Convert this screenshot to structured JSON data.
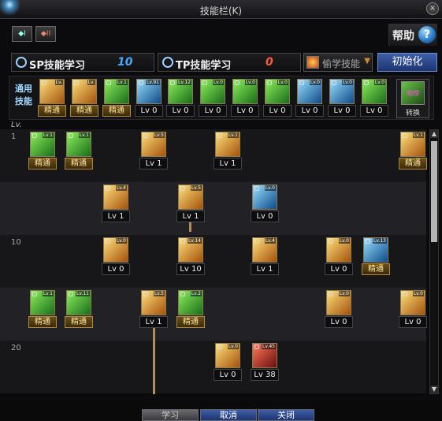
{
  "window": {
    "title": "技能栏(K)",
    "close_glyph": "×"
  },
  "tabs": [
    {
      "label": "◆I"
    },
    {
      "label": "◆II"
    }
  ],
  "help": {
    "label": "帮助",
    "icon": "?"
  },
  "points": {
    "sp": {
      "label": "SP技能学习",
      "value": "10",
      "color": "#4aa8ff"
    },
    "tp": {
      "label": "TP技能学习",
      "value": "0",
      "color": "#ff5a3a"
    }
  },
  "steal_dropdown": {
    "label": "偷学技能",
    "arrow": "▼"
  },
  "reset_button": {
    "label": "初始化"
  },
  "common": {
    "tag_line1": "通用",
    "tag_line2": "技能",
    "skills": [
      {
        "tag": "Lv.",
        "cap": "精通",
        "style": "mastered",
        "tone": "gold"
      },
      {
        "tag": "Lv.",
        "cap": "精通",
        "style": "mastered",
        "tone": "gold"
      },
      {
        "tag": "Lv.1",
        "cap": "精通",
        "style": "mastered",
        "tone": "green"
      },
      {
        "tag": "Lv.91",
        "cap": "Lv 0",
        "style": "level",
        "tone": "blue"
      },
      {
        "tag": "Lv.12",
        "cap": "Lv 0",
        "style": "level",
        "tone": "green"
      },
      {
        "tag": "Lv.0",
        "cap": "Lv 0",
        "style": "level",
        "tone": "green"
      },
      {
        "tag": "Lv.0",
        "cap": "Lv 0",
        "style": "level",
        "tone": "green"
      },
      {
        "tag": "Lv.0",
        "cap": "Lv 0",
        "style": "level",
        "tone": "green"
      },
      {
        "tag": "Lv.0",
        "cap": "Lv 0",
        "style": "level",
        "tone": "blue"
      },
      {
        "tag": "Lv.0",
        "cap": "Lv 0",
        "style": "level",
        "tone": "blue"
      },
      {
        "tag": "Lv.0",
        "cap": "Lv 0",
        "style": "level",
        "tone": "green"
      }
    ],
    "swap": {
      "icon_text": "物理",
      "label": "转换"
    }
  },
  "level_header": "Lv.",
  "row_levels": [
    "1",
    "10",
    "20"
  ],
  "tree": [
    {
      "tag": "Lv.1",
      "cap": "精通",
      "style": "mastered",
      "tone": "green"
    },
    {
      "tag": "Lv.1",
      "cap": "精通",
      "style": "mastered",
      "tone": "green"
    },
    {
      "tag": "Lv.5",
      "cap": "Lv 1",
      "style": "level",
      "tone": "gold"
    },
    {
      "tag": "Lv.1",
      "cap": "Lv 1",
      "style": "level",
      "tone": "gold"
    },
    {
      "tag": "Lv.1",
      "cap": "精通",
      "style": "mastered",
      "tone": "gold"
    },
    {
      "tag": "Lv.4",
      "cap": "Lv 1",
      "style": "level",
      "tone": "gold"
    },
    {
      "tag": "Lv.5",
      "cap": "Lv 1",
      "style": "level",
      "tone": "gold"
    },
    {
      "tag": "Lv.0",
      "cap": "Lv 0",
      "style": "level",
      "tone": "blue"
    },
    {
      "tag": "Lv.0",
      "cap": "Lv 0",
      "style": "level",
      "tone": "gold"
    },
    {
      "tag": "Lv.14",
      "cap": "Lv 10",
      "style": "level",
      "tone": "gold"
    },
    {
      "tag": "Lv.4",
      "cap": "Lv 1",
      "style": "level",
      "tone": "gold"
    },
    {
      "tag": "Lv.0",
      "cap": "Lv 0",
      "style": "level",
      "tone": "gold"
    },
    {
      "tag": "Lv.13",
      "cap": "精通",
      "style": "mastered",
      "tone": "blue"
    },
    {
      "tag": "Lv.1",
      "cap": "精通",
      "style": "mastered",
      "tone": "green"
    },
    {
      "tag": "Lv.11",
      "cap": "精通",
      "style": "mastered",
      "tone": "green"
    },
    {
      "tag": "Lv.5",
      "cap": "Lv 1",
      "style": "level",
      "tone": "gold"
    },
    {
      "tag": "Lv.2",
      "cap": "精通",
      "style": "mastered",
      "tone": "green"
    },
    {
      "tag": "Lv.0",
      "cap": "Lv 0",
      "style": "level",
      "tone": "gold"
    },
    {
      "tag": "Lv.0",
      "cap": "Lv 0",
      "style": "level",
      "tone": "gold"
    },
    {
      "tag": "Lv.0",
      "cap": "Lv 0",
      "style": "level",
      "tone": "gold"
    },
    {
      "tag": "Lv.45",
      "cap": "Lv 38",
      "style": "level",
      "tone": "red"
    }
  ],
  "scrollbar": {
    "up": "▲",
    "down": "▼"
  },
  "buttons": {
    "learn": "学习",
    "cancel": "取消",
    "close": "关闭"
  }
}
